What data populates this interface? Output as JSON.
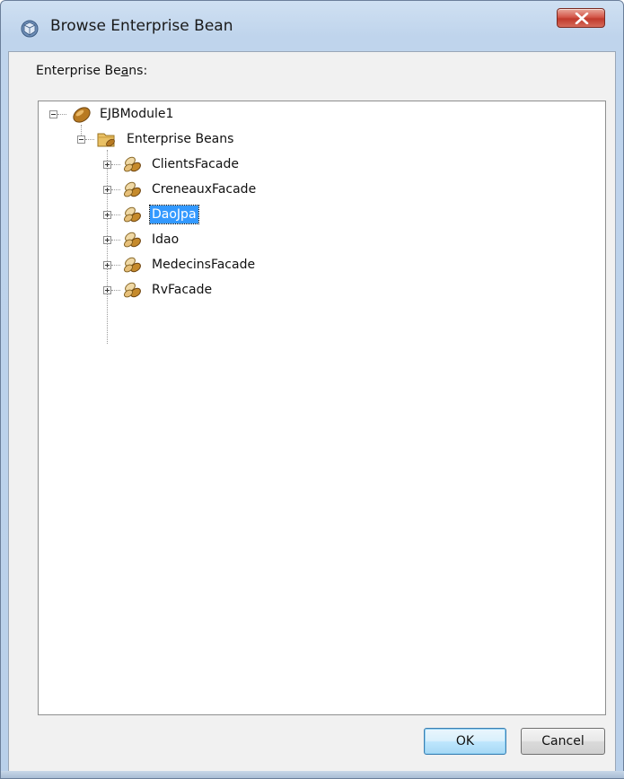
{
  "window": {
    "title": "Browse Enterprise Bean",
    "close_glyph": "X"
  },
  "panel": {
    "label_prefix": "Enterprise Be",
    "label_mnemonic": "a",
    "label_suffix": "ns:"
  },
  "tree": {
    "root": {
      "label": "EJBModule1",
      "icon": "ejb-module-icon",
      "expanded": true
    },
    "folder": {
      "label": "Enterprise Beans",
      "icon": "enterprise-beans-folder-icon",
      "expanded": true
    },
    "beans": [
      {
        "label": "ClientsFacade",
        "icon": "session-bean-icon",
        "selected": false
      },
      {
        "label": "CreneauxFacade",
        "icon": "session-bean-icon",
        "selected": false
      },
      {
        "label": "DaoJpa",
        "icon": "session-bean-icon",
        "selected": true
      },
      {
        "label": "Idao",
        "icon": "session-bean-icon",
        "selected": false
      },
      {
        "label": "MedecinsFacade",
        "icon": "session-bean-icon",
        "selected": false
      },
      {
        "label": "RvFacade",
        "icon": "session-bean-icon",
        "selected": false
      }
    ]
  },
  "buttons": {
    "ok_label": "OK",
    "cancel_label": "Cancel"
  },
  "colors": {
    "selection": "#3399ff",
    "titlebar": "#bfd4ec",
    "close_button": "#c13a2c"
  }
}
